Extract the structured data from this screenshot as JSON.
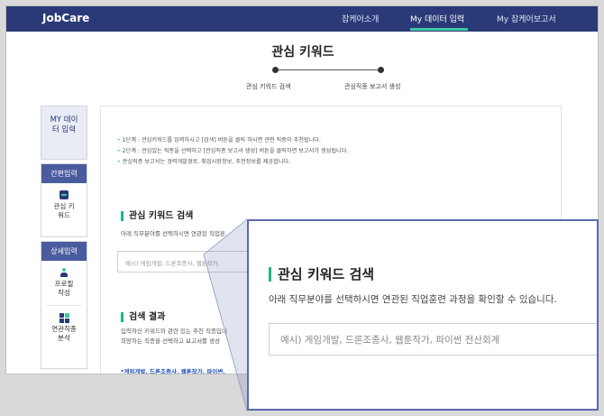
{
  "nav": {
    "brand": "JobCare",
    "items": [
      "잡케어소개",
      "My 데이터 입력",
      "My 잡케어보고서"
    ]
  },
  "page": {
    "title": "관심 키워드",
    "steps": [
      "관심 키워드 검색",
      "관심직종 보고서 생성"
    ]
  },
  "sidebar": {
    "my_label": "MY 데이터 입력",
    "quick_header": "간편입력",
    "quick_items": [
      "관심 키워드"
    ],
    "detail_header": "상세입력",
    "detail_items": [
      "프로필 작성",
      "연관직종 분석"
    ]
  },
  "main": {
    "notices": [
      "1단계 : 관심키워드를 입력하시고 [검색] 버튼을 클릭 하시면 관련 직종이 추천됩니다.",
      "2단계 : 관심있는 직종을 선택하고 [관심직종 보고서 생성] 버튼을 클릭하면 보고서가 생성됩니다.",
      "관심직종 보고서는 경력개발경로, 취업시장정보, 추천정보를 제공합니다."
    ],
    "search_title": "관심 키워드 검색",
    "search_desc": "아래 직무분야를 선택하시면 연관된 직업훈",
    "search_placeholder": "예시) 게임개발, 드론조종사, 웹툰작가, ",
    "result_title": "검색 결과",
    "result_desc_1": "입력하신 키워드와 관련 있는 추천 직종입니",
    "result_desc_2": "희망하는 직종을 선택하고 보고서를 생성",
    "result_tags": "*게임개발, 드론조종사, 웹툰작가, 파이썬,"
  },
  "zoom": {
    "title": "관심 키워드 검색",
    "desc": "아래 직무분야를 선택하시면 연관된 직업훈련 과정을 확인할 수 있습니다.",
    "placeholder": "예시) 게임개발, 드론조종사, 웹툰작가, 파이썬 전산회계"
  }
}
